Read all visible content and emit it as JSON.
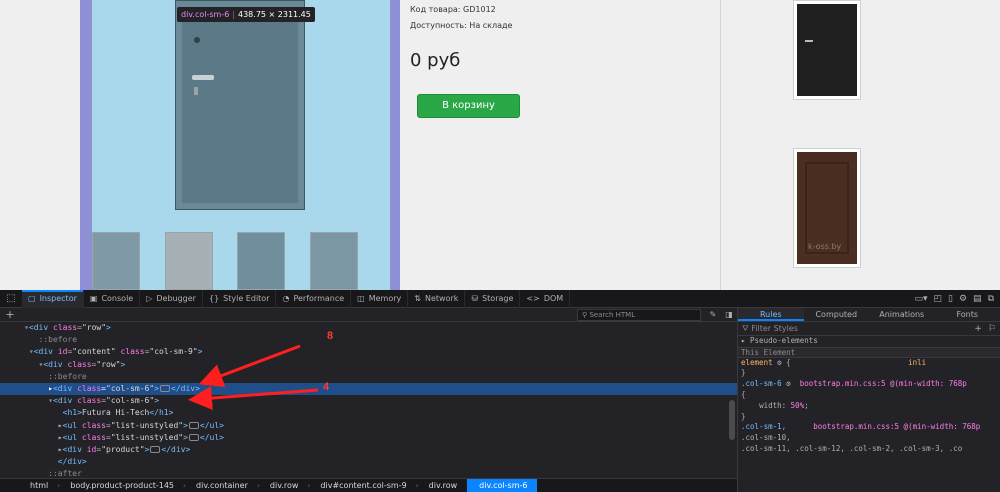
{
  "webpage": {
    "tooltip": {
      "selector": "div.col-sm-6",
      "size": "438.75 × 2311.45"
    },
    "product_code": "Код товара: GD1012",
    "availability": "Доступность: На складе",
    "price": "0 руб",
    "cart_button": "В корзину",
    "watermark": "k-oss.by"
  },
  "devtools": {
    "toolbar": {
      "tabs": [
        {
          "label": "Inspector",
          "icon": "inspector-icon"
        },
        {
          "label": "Console",
          "icon": "console-icon"
        },
        {
          "label": "Debugger",
          "icon": "debugger-icon"
        },
        {
          "label": "Style Editor",
          "icon": "style-editor-icon"
        },
        {
          "label": "Performance",
          "icon": "performance-icon"
        },
        {
          "label": "Memory",
          "icon": "memory-icon"
        },
        {
          "label": "Network",
          "icon": "network-icon"
        },
        {
          "label": "Storage",
          "icon": "storage-icon"
        },
        {
          "label": "DOM",
          "icon": "dom-icon"
        }
      ]
    },
    "search_placeholder": "Search HTML",
    "tree": {
      "row0_tag": "<div",
      "row0_attr": "class",
      "row0_val": "\"row\"",
      "row0_close": ">",
      "before1": "::before",
      "content_tag": "<div",
      "content_attr1": "id",
      "content_val1": "\"content\"",
      "content_attr2": "class",
      "content_val2": "\"col-sm-9\"",
      "row_tag": "<div",
      "row_attr": "class",
      "row_val": "\"row\"",
      "before2": "::before",
      "sel_tag": "<div",
      "sel_attr": "class",
      "sel_val": "\"col-sm-6\"",
      "sel_end": "</div>",
      "col6_tag": "<div",
      "col6_attr": "class",
      "col6_val": "\"col-sm-6\"",
      "h1_open": "<h1>",
      "h1_text": "Futura Hi-Tech",
      "h1_close": "</h1>",
      "ul1_tag": "<ul",
      "ul1_attr": "class",
      "ul1_val": "\"list-unstyled\"",
      "ul1_end": "</ul>",
      "ul2_tag": "<ul",
      "ul2_attr": "class",
      "ul2_val": "\"list-unstyled\"",
      "ul2_end": "</ul>",
      "prod_tag": "<div",
      "prod_attr": "id",
      "prod_val": "\"product\"",
      "prod_end": "</div>",
      "close_div": "</div>",
      "after": "::after"
    },
    "breadcrumbs": [
      "html",
      "body.product-product-145",
      "div.container",
      "div.row",
      "div#content.col-sm-9",
      "div.row",
      "div.col-sm-6"
    ],
    "sidebar": {
      "tabs": [
        "Rules",
        "Computed",
        "Animations",
        "Fonts"
      ],
      "filter_placeholder": "Filter Styles",
      "pseudo": "Pseudo-elements",
      "this_element": "This Element",
      "element_rule": "element",
      "element_inline": "inli",
      "rule1_sel": ".col-sm-6",
      "rule1_src": "bootstrap.min.css:5 @(min-width: 768p",
      "rule1_prop": "width",
      "rule1_val": "50%",
      "rule2_sel": ".col-sm-1,",
      "rule2_src": "bootstrap.min.css:5 @(min-width: 768p",
      "rule2_sel2": ".col-sm-10,",
      "rule2_sel3": ".col-sm-11, .col-sm-12, .col-sm-2, .col-sm-3, .co"
    }
  },
  "annotations": {
    "label_top": "8",
    "label_bottom": "4"
  },
  "colors": {
    "accent": "#0a84ff",
    "selected_row": "#204e8a",
    "tag": "#75bfff",
    "attr": "#ff7de9",
    "arrow": "#ff1f1f",
    "button": "#2aa847"
  }
}
